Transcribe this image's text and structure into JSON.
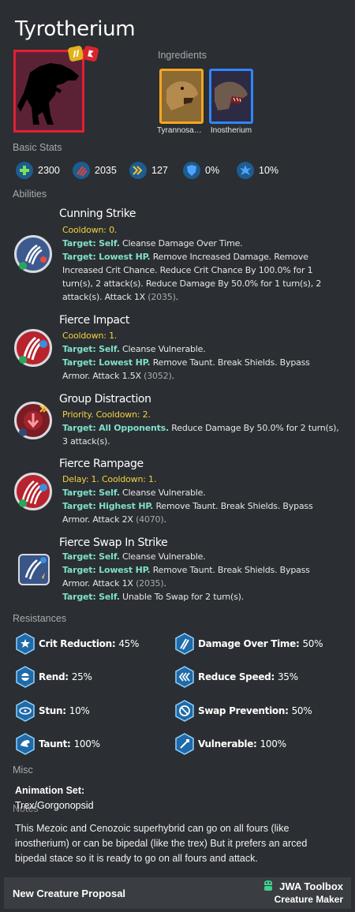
{
  "creature": {
    "name": "Tyrotherium"
  },
  "ingredients": {
    "label": "Ingredients",
    "items": [
      {
        "name": "Tyrannosau…",
        "rarity_color": "#f5a623"
      },
      {
        "name": "Inostherium",
        "rarity_color": "#2f86ff"
      }
    ]
  },
  "stats": {
    "label": "Basic Stats",
    "items": [
      {
        "icon": "health-icon",
        "value": "2300"
      },
      {
        "icon": "damage-icon",
        "value": "2035"
      },
      {
        "icon": "speed-icon",
        "value": "127"
      },
      {
        "icon": "armor-icon",
        "value": "0%"
      },
      {
        "icon": "crit-icon",
        "value": "10%"
      }
    ]
  },
  "abilities": {
    "label": "Abilities",
    "items": [
      {
        "name": "Cunning Strike",
        "line1": "Cooldown: 0.",
        "t1": "Target: Self.",
        "d1": " Cleanse Damage Over Time.",
        "t2": "Target: Lowest HP.",
        "d2": " Remove Increased Damage. Remove Increased Crit Chance. Reduce Crit Chance By 100.0% for 1 turn(s), 2 attack(s). Reduce Damage By 50.0% for 1 turn(s), 2 attack(s). Attack 1X ",
        "dmg": "(2035)",
        "end": "."
      },
      {
        "name": "Fierce Impact",
        "line1": "Cooldown: 1.",
        "t1": "Target: Self.",
        "d1": " Cleanse Vulnerable.",
        "t2": "Target: Lowest HP.",
        "d2": " Remove Taunt. Break Shields. Bypass Armor. Attack 1.5X ",
        "dmg": "(3052)",
        "end": "."
      },
      {
        "name": "Group Distraction",
        "line1": "Priority. Cooldown: 2.",
        "t1": "Target: All Opponents.",
        "d1": " Reduce Damage By 50.0% for 2 turn(s), 3 attack(s)."
      },
      {
        "name": "Fierce Rampage",
        "line1": "Delay: 1. Cooldown: 1.",
        "t1": "Target: Self.",
        "d1": " Cleanse Vulnerable.",
        "t2": "Target: Highest HP.",
        "d2": " Remove Taunt. Break Shields. Bypass Armor. Attack 2X ",
        "dmg": "(4070)",
        "end": "."
      },
      {
        "name": "Fierce Swap In Strike",
        "t1": "Target: Self.",
        "d1": " Cleanse Vulnerable.",
        "t2": "Target: Lowest HP.",
        "d2": " Remove Taunt. Break Shields. Bypass Armor. Attack 1X ",
        "dmg": "(2035)",
        "end": ".",
        "t3": "Target: Self.",
        "d3": " Unable To Swap for 2 turn(s)."
      }
    ]
  },
  "resistances": {
    "label": "Resistances",
    "items": [
      {
        "label": "Crit Reduction:",
        "value": "45%",
        "icon": "crit-reduction-icon"
      },
      {
        "label": "Damage Over Time:",
        "value": "50%",
        "icon": "damage-over-time-icon"
      },
      {
        "label": "Rend:",
        "value": "25%",
        "icon": "rend-icon"
      },
      {
        "label": "Reduce Speed:",
        "value": "35%",
        "icon": "reduce-speed-icon"
      },
      {
        "label": "Stun:",
        "value": "10%",
        "icon": "stun-icon"
      },
      {
        "label": "Swap Prevention:",
        "value": "50%",
        "icon": "swap-prevention-icon"
      },
      {
        "label": "Taunt:",
        "value": "100%",
        "icon": "taunt-icon"
      },
      {
        "label": "Vulnerable:",
        "value": "100%",
        "icon": "vulnerable-icon"
      }
    ]
  },
  "misc": {
    "label": "Misc",
    "animation_title": "Animation Set:",
    "animation_value": "Trex/Gorgonopsid",
    "notes_label": "Notes",
    "notes": "This Mezoic and Cenozoic superhybrid can go on all fours (like inostherium) or can be bipedal (like the trex) But it prefers an arced bipedal stace so it is ready to go on all fours and attack."
  },
  "footer": {
    "left": "New Creature Proposal",
    "brand": "JWA Toolbox",
    "sub": "Creature Maker"
  },
  "colors": {
    "background": "#2b2e32",
    "cooldown": "#f2d33e",
    "target": "#7fe0c8",
    "portrait_border": "#e02233",
    "stat_icon": "#1d5c8f"
  }
}
